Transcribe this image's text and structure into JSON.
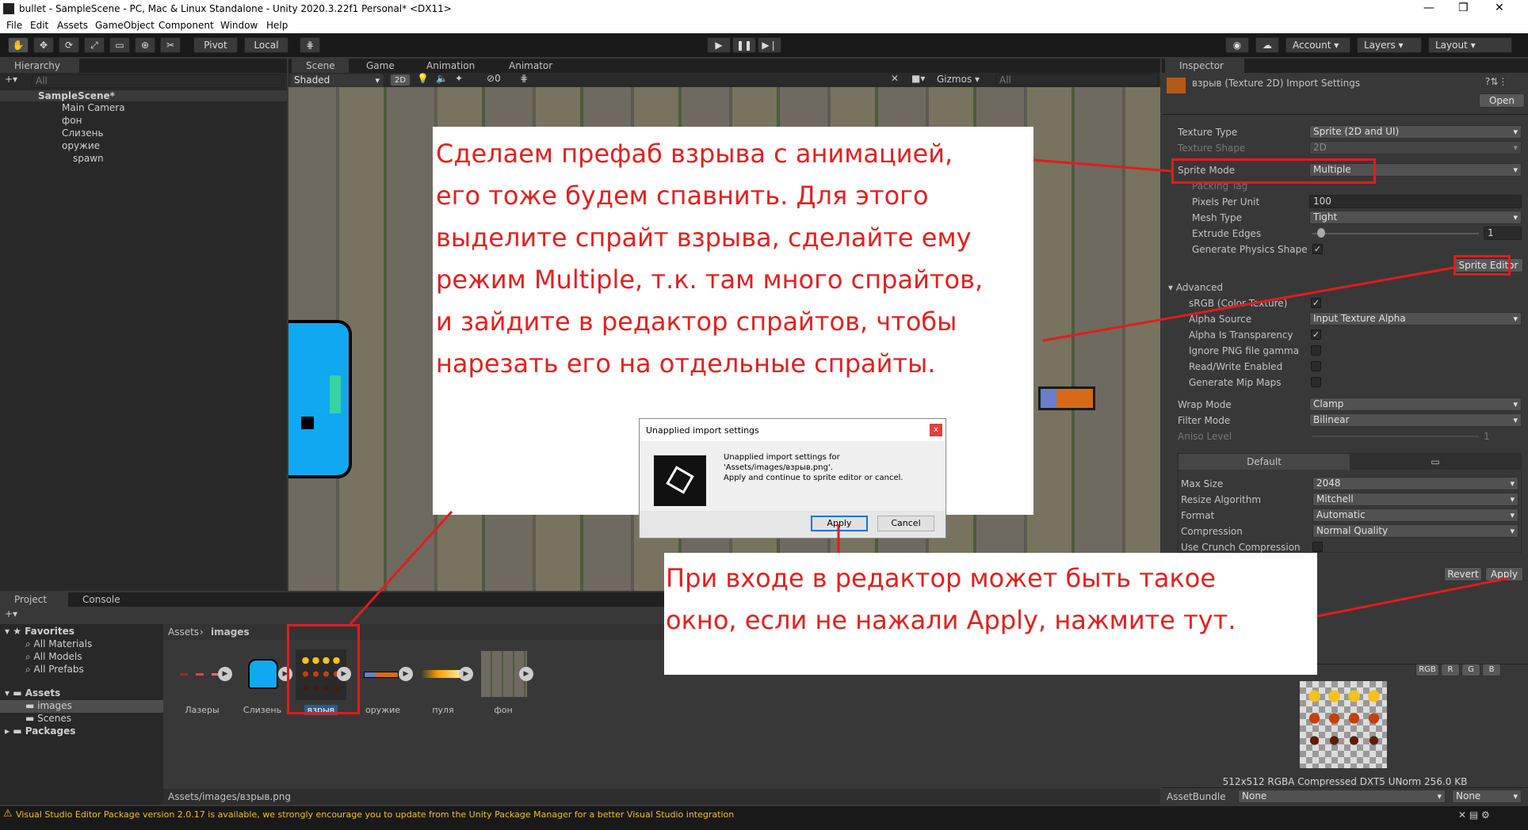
{
  "window": {
    "title": "bullet - SampleScene - PC, Mac & Linux Standalone - Unity 2020.3.22f1 Personal* <DX11>",
    "minimize": "—",
    "maximize": "❐",
    "close": "✕"
  },
  "menu": [
    "File",
    "Edit",
    "Assets",
    "GameObject",
    "Component",
    "Window",
    "Help"
  ],
  "toolbar": {
    "pivot": "Pivot",
    "local": "Local",
    "account": "Account",
    "layers": "Layers",
    "layout": "Layout"
  },
  "hierarchy": {
    "tab": "Hierarchy",
    "search_placeholder": "All",
    "scene": "SampleScene*",
    "items": [
      "Main Camera",
      "фон",
      "Слизень",
      "оружие",
      "spawn"
    ]
  },
  "scene": {
    "tabs": [
      "Scene",
      "Game",
      "Animation",
      "Animator"
    ],
    "shading": "Shaded",
    "mode2d": "2D",
    "gizmos": "Gizmos",
    "search_placeholder": "All",
    "hidden_count": "0"
  },
  "dialog": {
    "title": "Unapplied import settings",
    "line1": "Unapplied import settings for",
    "line2": "'Assets/images/взрыв.png'.",
    "line3": "Apply and continue to sprite editor or cancel.",
    "apply": "Apply",
    "cancel": "Cancel",
    "close": "x"
  },
  "inspector": {
    "tab": "Inspector",
    "header": "взрыв (Texture 2D) Import Settings",
    "open": "Open",
    "rows": [
      {
        "label": "Texture Type",
        "value": "Sprite (2D and UI)"
      },
      {
        "label": "Texture Shape",
        "value": "2D"
      },
      {
        "label": "Sprite Mode",
        "value": "Multiple"
      },
      {
        "label": "Packing Tag",
        "value": ""
      },
      {
        "label": "Pixels Per Unit",
        "value": "100"
      },
      {
        "label": "Mesh Type",
        "value": "Tight"
      },
      {
        "label": "Extrude Edges",
        "value": "1"
      },
      {
        "label": "Generate Physics Shape",
        "value": "✓"
      }
    ],
    "sprite_editor": "Sprite Editor",
    "advanced": "Advanced",
    "adv_rows": [
      {
        "label": "sRGB (Color Texture)",
        "value": "✓"
      },
      {
        "label": "Alpha Source",
        "value": "Input Texture Alpha"
      },
      {
        "label": "Alpha Is Transparency",
        "value": "✓"
      },
      {
        "label": "Ignore PNG file gamma",
        "value": ""
      },
      {
        "label": "Read/Write Enabled",
        "value": ""
      },
      {
        "label": "Generate Mip Maps",
        "value": ""
      }
    ],
    "wrap_mode": {
      "label": "Wrap Mode",
      "value": "Clamp"
    },
    "filter_mode": {
      "label": "Filter Mode",
      "value": "Bilinear"
    },
    "aniso": {
      "label": "Aniso Level",
      "value": "1"
    },
    "platform_tab": "Default",
    "platform_rows": [
      {
        "label": "Max Size",
        "value": "2048"
      },
      {
        "label": "Resize Algorithm",
        "value": "Mitchell"
      },
      {
        "label": "Format",
        "value": "Automatic"
      },
      {
        "label": "Compression",
        "value": "Normal Quality"
      },
      {
        "label": "Use Crunch Compression",
        "value": ""
      }
    ],
    "revert": "Revert",
    "apply": "Apply",
    "channels": [
      "RGB",
      "R",
      "G",
      "B"
    ],
    "preview_info": "512x512  RGBA Compressed DXT5 UNorm  256.0 KB",
    "assetbundle_label": "AssetBundle",
    "assetbundle_value": "None",
    "assetbundle_variant": "None"
  },
  "project": {
    "tabs": [
      "Project",
      "Console"
    ],
    "favorites": "Favorites",
    "fav_items": [
      "All Materials",
      "All Models",
      "All Prefabs"
    ],
    "assets": "Assets",
    "asset_folders": [
      "images",
      "Scenes"
    ],
    "packages": "Packages",
    "breadcrumb": [
      "Assets",
      "images"
    ],
    "items": [
      "Лазеры",
      "Слизень",
      "взрыв",
      "оружие",
      "пуля",
      "фон"
    ],
    "path": "Assets/images/взрыв.png"
  },
  "statusbar": {
    "message": "Visual Studio Editor Package version 2.0.17 is available, we strongly encourage you to update from the Unity Package Manager for a better Visual Studio integration"
  },
  "notes": {
    "top": [
      "Сделаем префаб взрыва с анимацией,",
      "его тоже будем спавнить. Для этого",
      "выделите спрайт взрыва, сделайте ему",
      "режим Multiple, т.к. там много спрайтов,",
      "и зайдите в редактор спрайтов, чтобы",
      "нарезать его на отдельные спрайты."
    ],
    "bottom": [
      "При входе в редактор может быть такое",
      "окно, если не нажали Apply, нажмите тут."
    ]
  },
  "colors": {
    "annotation_red": "#e21c1c",
    "selection_blue": "#2c5d87",
    "warning_yellow": "#f0c020"
  }
}
